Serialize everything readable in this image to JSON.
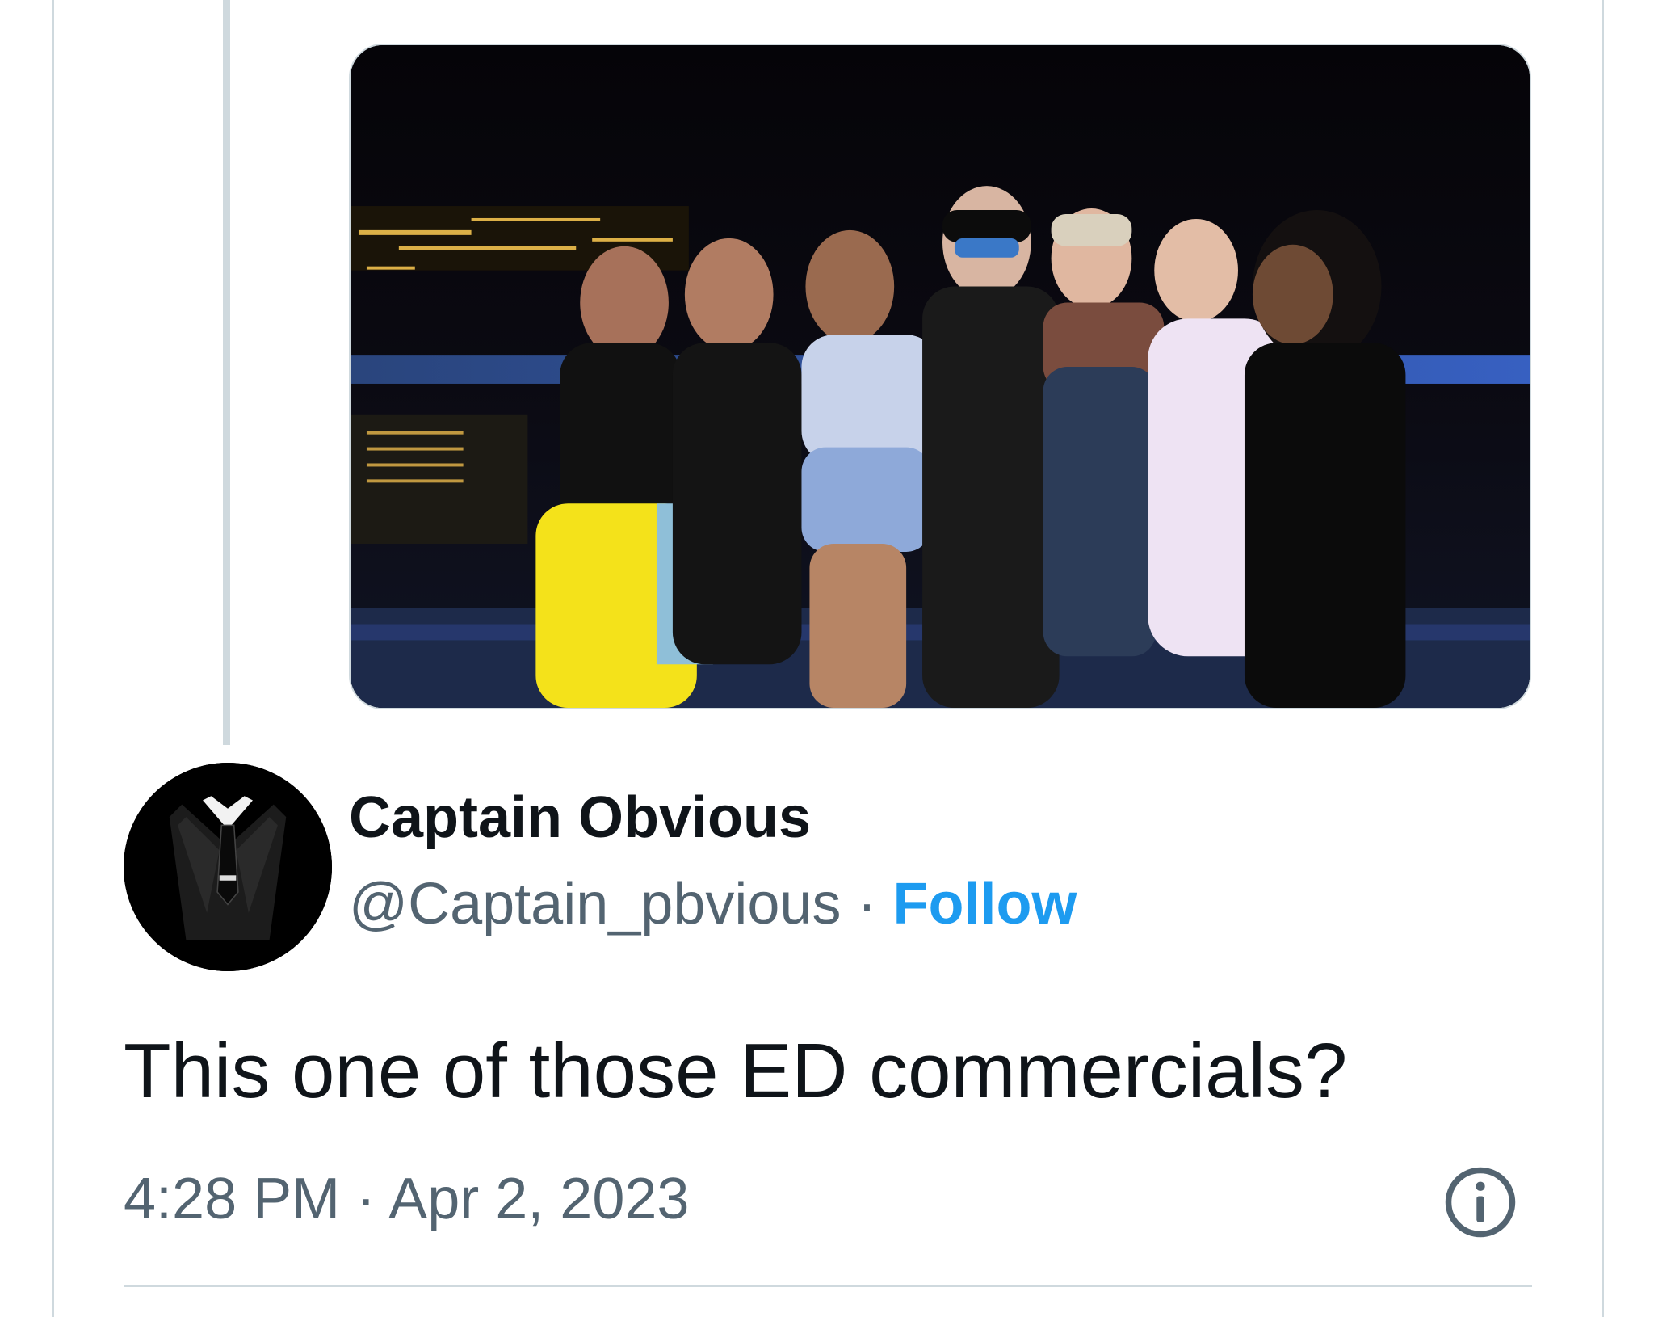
{
  "tweet": {
    "author": {
      "display_name": "Captain Obvious",
      "handle": "@Captain_pbvious",
      "follow_label": "Follow",
      "separator": "·"
    },
    "text": "This one of those ED commercials?",
    "timestamp": {
      "time": "4:28 PM",
      "separator": "·",
      "date": "Apr 2, 2023"
    },
    "icons": {
      "info": "info-icon",
      "avatar": "suit-and-tie-avatar"
    },
    "colors": {
      "link": "#1d9bf0",
      "secondary_text": "#536471",
      "primary_text": "#0f1419",
      "border": "#cfd9de"
    }
  }
}
